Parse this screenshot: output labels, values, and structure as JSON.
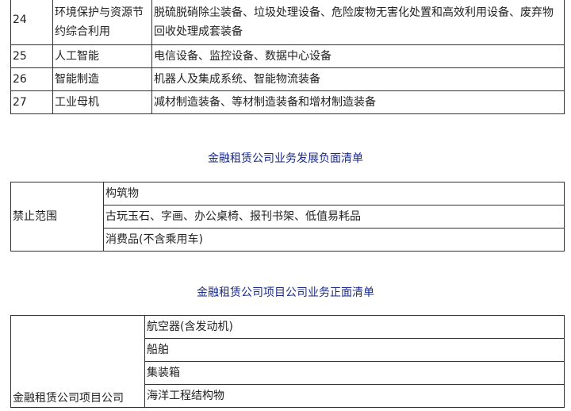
{
  "top_table": {
    "rows": [
      {
        "num": "24",
        "category": "环境保护与资源节约综合利用",
        "items": "脱硫脱硝除尘装备、垃圾处理设备、危险废物无害化处置和高效利用设备、废弃物回收处理成套装备"
      },
      {
        "num": "25",
        "category": "人工智能",
        "items": "电信设备、监控设备、数据中心设备"
      },
      {
        "num": "26",
        "category": "智能制造",
        "items": "机器人及集成系统、智能物流装备"
      },
      {
        "num": "27",
        "category": "工业母机",
        "items": "减材制造装备、等材制造装备和增材制造装备"
      }
    ]
  },
  "negative_list": {
    "title": "金融租赁公司业务发展负面清单",
    "scope_label": "禁止范围",
    "items": [
      "构筑物",
      "古玩玉石、字画、办公桌椅、报刊书架、低值易耗品",
      "消费品(不含乘用车)"
    ]
  },
  "positive_list": {
    "title": "金融租赁公司项目公司业务正面清单",
    "company_label": "金融租赁公司项目公司",
    "items": [
      "航空器(含发动机)",
      "船舶",
      "集装箱",
      "海洋工程结构物"
    ]
  }
}
